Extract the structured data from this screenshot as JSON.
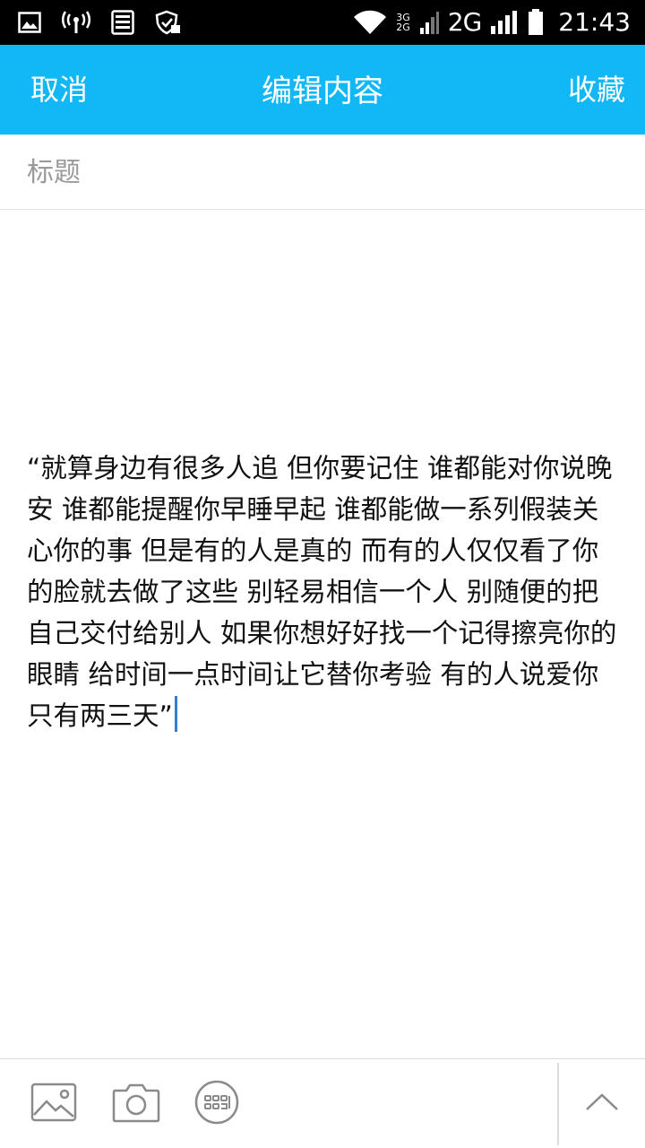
{
  "status_bar": {
    "network_small_top": "3G",
    "network_small_bottom": "2G",
    "network_type": "2G",
    "time": "21:43"
  },
  "navbar": {
    "cancel_label": "取消",
    "title": "编辑内容",
    "favorite_label": "收藏",
    "accent_color": "#12b7f5"
  },
  "editor": {
    "title_placeholder": "标题",
    "title_value": "",
    "content": "“就算身边有很多人追 但你要记住 谁都能对你说晚安 谁都能提醒你早睡早起 谁都能做一系列假装关心你的事 但是有的人是真的 而有的人仅仅看了你的脸就去做了这些 别轻易相信一个人 别随便的把自己交付给别人 如果你想好好找一个记得擦亮你的眼睛 给时间一点时间让它替你考验 有的人说爱你只有两三天”"
  },
  "toolbar": {
    "icons": [
      "image-icon",
      "camera-icon",
      "keyboard-icon",
      "chevron-up-icon"
    ]
  }
}
